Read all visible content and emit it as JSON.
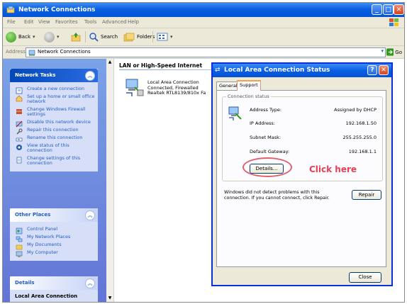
{
  "window": {
    "title": "Network Connections",
    "icon": "network-folder-icon"
  },
  "menubar": [
    "File",
    "Edit",
    "View",
    "Favorites",
    "Tools",
    "Advanced",
    "Help"
  ],
  "toolbar": {
    "back": "Back",
    "search": "Search",
    "folders": "Folders"
  },
  "address": {
    "label": "Address",
    "value": "Network Connections",
    "go": "Go"
  },
  "sidebar": {
    "network_tasks": {
      "title": "Network Tasks",
      "items": [
        "Create a new connection",
        "Set up a home or small office network",
        "Change Windows Firewall settings",
        "Disable this network device",
        "Repair this connection",
        "Rename this connection",
        "View status of this connection",
        "Change settings of this connection"
      ]
    },
    "other_places": {
      "title": "Other Places",
      "items": [
        "Control Panel",
        "My Network Places",
        "My Documents",
        "My Computer"
      ]
    },
    "details": {
      "title": "Details",
      "subtitle": "Local Area Connection"
    }
  },
  "main": {
    "group_header": "LAN or High-Speed Internet",
    "connection": {
      "name": "Local Area Connection",
      "status": "Connected, Firewalled",
      "device": "Realtek RTL8139/810x Fa"
    }
  },
  "dialog": {
    "title": "Local Area Connection Status",
    "tabs": [
      "General",
      "Support"
    ],
    "active_tab": "Support",
    "group_label": "Connection status",
    "rows": [
      {
        "label": "Address Type:",
        "value": "Assigned by DHCP"
      },
      {
        "label": "IP Address:",
        "value": "192.168.1.50"
      },
      {
        "label": "Subnet Mask:",
        "value": "255.255.255.0"
      },
      {
        "label": "Default Gateway:",
        "value": "192.168.1.1"
      }
    ],
    "details_button": "Details...",
    "annotation": "Click here",
    "message": "Windows did not detect problems with this connection. If you cannot connect, click Repair.",
    "repair_button": "Repair",
    "close_button": "Close"
  }
}
